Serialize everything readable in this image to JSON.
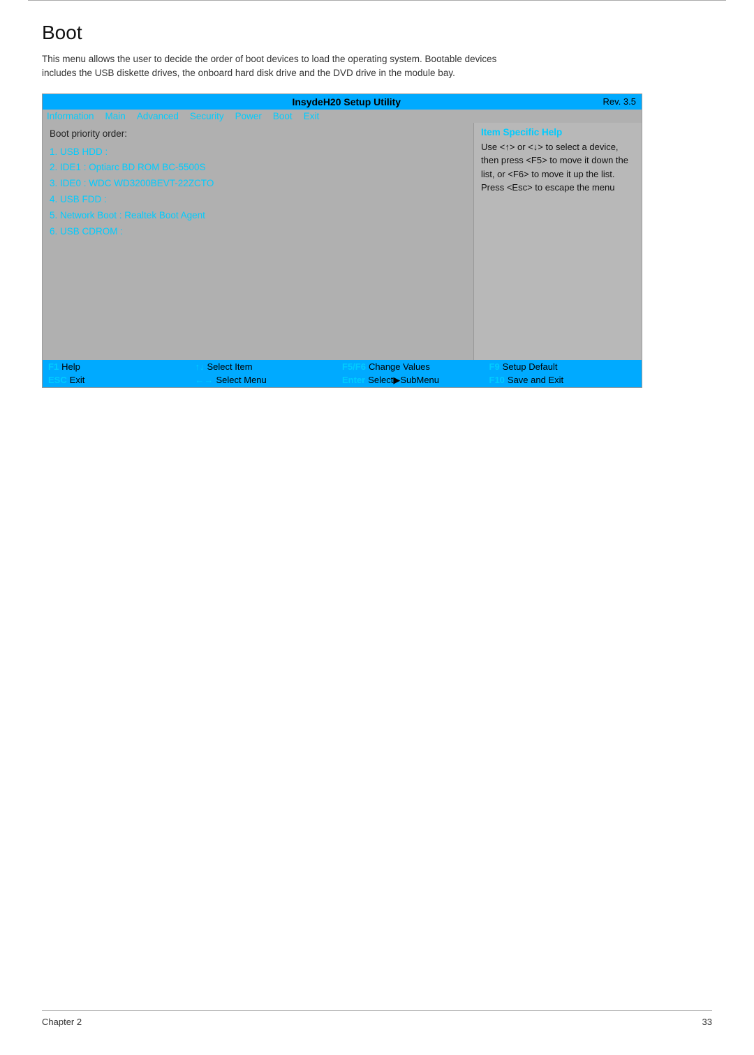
{
  "page": {
    "title": "Boot",
    "description": "This menu allows the user to decide the order of boot devices to load the operating system. Bootable devices includes the USB diskette drives, the onboard hard disk drive and the DVD drive in the module bay.",
    "chapter": "Chapter 2",
    "page_number": "33"
  },
  "bios": {
    "header_title": "InsydeH20 Setup Utility",
    "header_rev": "Rev. 3.5",
    "nav_items": [
      {
        "label": "Information",
        "active": true
      },
      {
        "label": "Main",
        "active": true
      },
      {
        "label": "Advanced",
        "active": true
      },
      {
        "label": "Security",
        "active": true
      },
      {
        "label": "Power",
        "active": true
      },
      {
        "label": "Boot",
        "active": true,
        "current": true
      },
      {
        "label": "Exit",
        "active": true
      }
    ],
    "section_label": "Boot priority order:",
    "boot_items": [
      "1. USB HDD :",
      "2. IDE1 : Optiarc BD ROM BC-5500S",
      "3. IDE0 : WDC WD3200BEVT-22ZCTO",
      "4. USB FDD :",
      "5. Network Boot : Realtek Boot Agent",
      "6. USB CDROM :"
    ],
    "help": {
      "title": "Item Specific Help",
      "text": "Use <↑> or <↓> to select a device, then press <F5> to move it down the list, or <F6> to move it up the list. Press <Esc> to escape the menu"
    },
    "footer_rows": [
      [
        {
          "key": "F1",
          "desc": "Help"
        },
        {
          "key": "↑↓",
          "desc": "Select Item"
        },
        {
          "key": "F5/F6",
          "desc": "Change Values"
        },
        {
          "key": "F9",
          "desc": "Setup Default"
        }
      ],
      [
        {
          "key": "ESC",
          "desc": "Exit"
        },
        {
          "key": "←→",
          "desc": "Select Menu"
        },
        {
          "key": "Enter",
          "desc": "Select▶SubMenu"
        },
        {
          "key": "F10",
          "desc": "Save and Exit"
        }
      ]
    ]
  }
}
